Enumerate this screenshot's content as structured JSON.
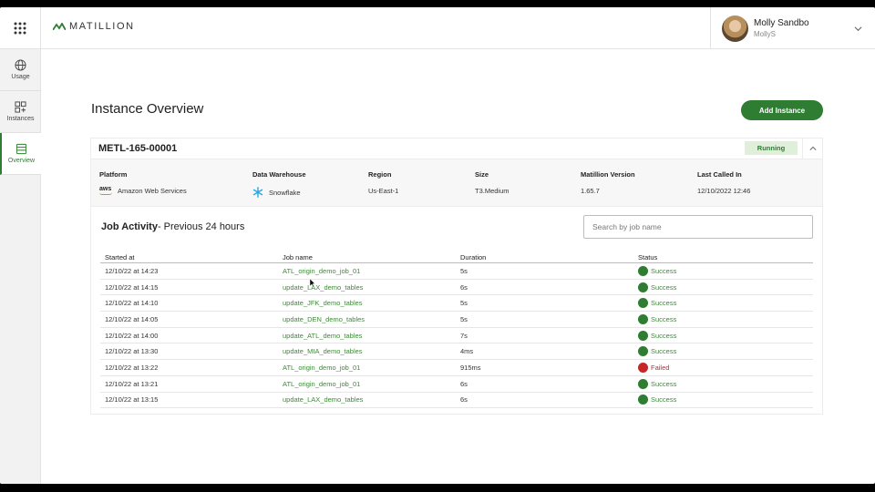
{
  "brand": {
    "logo_text": "MATILLION",
    "accent": "#2e7d32"
  },
  "user": {
    "name": "Molly Sandbo",
    "handle": "MollyS"
  },
  "sidebar": {
    "items": [
      {
        "label": "Usage",
        "icon": "globe-icon"
      },
      {
        "label": "Instances",
        "icon": "instances-icon"
      },
      {
        "label": "Overview",
        "icon": "overview-icon",
        "active": true
      }
    ]
  },
  "main": {
    "title": "Instance Overview",
    "add_button": "Add Instance"
  },
  "instance": {
    "id": "METL-165-00001",
    "status": "Running",
    "fields": {
      "platform_label": "Platform",
      "platform_value": "Amazon Web Services",
      "warehouse_label": "Data Warehouse",
      "warehouse_value": "Snowflake",
      "region_label": "Region",
      "region_value": "Us-East-1",
      "size_label": "Size",
      "size_value": "T3.Medium",
      "version_label": "Matillion Version",
      "version_value": "1.65.7",
      "last_called_label": "Last Called In",
      "last_called_value": "12/10/2022 12:46"
    }
  },
  "job_activity": {
    "title": "Job Activity",
    "subtitle": "- Previous 24 hours",
    "search_placeholder": "Search by job name",
    "columns": [
      "Started at",
      "Job name",
      "Duration",
      "Status"
    ],
    "rows": [
      {
        "started": "12/10/22 at 14:23",
        "job": "ATL_origin_demo_job_01",
        "duration": "5s",
        "status": "Success"
      },
      {
        "started": "12/10/22 at 14:15",
        "job": "update_LAX_demo_tables",
        "duration": "6s",
        "status": "Success"
      },
      {
        "started": "12/10/22 at 14:10",
        "job": "update_JFK_demo_tables",
        "duration": "5s",
        "status": "Success"
      },
      {
        "started": "12/10/22 at 14:05",
        "job": "update_DEN_demo_tables",
        "duration": "5s",
        "status": "Success"
      },
      {
        "started": "12/10/22 at 14:00",
        "job": "update_ATL_demo_tables",
        "duration": "7s",
        "status": "Success"
      },
      {
        "started": "12/10/22 at 13:30",
        "job": "update_MIA_demo_tables",
        "duration": "4ms",
        "status": "Success"
      },
      {
        "started": "12/10/22 at 13:22",
        "job": "ATL_origin_demo_job_01",
        "duration": "915ms",
        "status": "Failed"
      },
      {
        "started": "12/10/22 at 13:21",
        "job": "ATL_origin_demo_job_01",
        "duration": "6s",
        "status": "Success"
      },
      {
        "started": "12/10/22 at 13:15",
        "job": "update_LAX_demo_tables",
        "duration": "6s",
        "status": "Success"
      }
    ]
  }
}
